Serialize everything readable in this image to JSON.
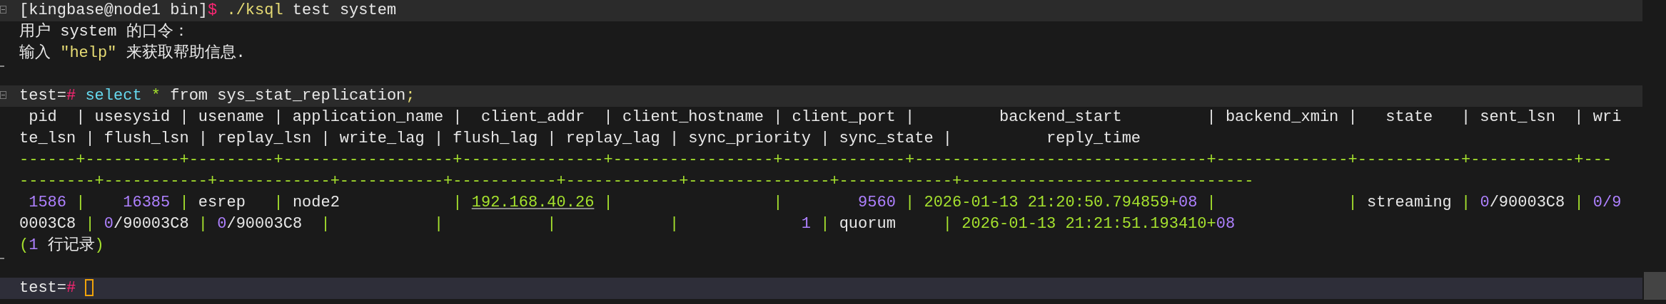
{
  "terminal": {
    "lines": [
      {
        "highlighted": true,
        "fold_start": true,
        "fold_end": false,
        "cursor": false,
        "segments": [
          {
            "text": "[kingbase@node1 bin]",
            "kind": "plain"
          },
          {
            "text": "$",
            "kind": "prompt"
          },
          {
            "text": " ./ksql",
            "kind": "command"
          },
          {
            "text": " test system",
            "kind": "plain"
          }
        ]
      },
      {
        "highlighted": false,
        "fold_start": false,
        "fold_end": false,
        "cursor": false,
        "segments": [
          {
            "text": "用户 system 的口令：",
            "kind": "plain"
          }
        ]
      },
      {
        "highlighted": false,
        "fold_start": false,
        "fold_end": false,
        "cursor": false,
        "segments": [
          {
            "text": "输入 ",
            "kind": "plain"
          },
          {
            "text": "\"help\"",
            "kind": "string"
          },
          {
            "text": " 来获取帮助信息.",
            "kind": "plain"
          }
        ]
      },
      {
        "highlighted": false,
        "fold_start": false,
        "fold_end": true,
        "cursor": false
      },
      {
        "highlighted": true,
        "fold_start": true,
        "fold_end": false,
        "cursor": false,
        "segments": [
          {
            "text": "test=",
            "kind": "plain"
          },
          {
            "text": "#",
            "kind": "prompt"
          },
          {
            "text": " select",
            "kind": "keyword"
          },
          {
            "text": " *",
            "kind": "operator"
          },
          {
            "text": " from sys_stat_replication",
            "kind": "plain"
          },
          {
            "text": ";",
            "kind": "punct"
          }
        ]
      },
      {
        "highlighted": false,
        "fold_start": false,
        "fold_end": false,
        "cursor": false,
        "segments": [
          {
            "text": " pid  | usesysid | usename | application_name |  client_addr  | client_hostname | client_port |         backend_start         | backend_xmin |   state   | sent_lsn  | wri",
            "kind": "plain"
          }
        ]
      },
      {
        "highlighted": false,
        "fold_start": false,
        "fold_end": false,
        "cursor": false,
        "segments": [
          {
            "text": "te_lsn | flush_lsn | replay_lsn | write_lag | flush_lag | replay_lag | sync_priority | sync_state |          reply_time",
            "kind": "plain"
          }
        ]
      },
      {
        "highlighted": false,
        "fold_start": false,
        "fold_end": false,
        "cursor": false,
        "segments": [
          {
            "text": "------+----------+---------+------------------+---------------+-----------------+-------------+-------------------------------+--------------+-----------+-----------+---",
            "kind": "border"
          }
        ]
      },
      {
        "highlighted": false,
        "fold_start": false,
        "fold_end": false,
        "cursor": false,
        "segments": [
          {
            "text": "--------+-----------+------------+-----------+-----------+------------+---------------+------------+-------------------------------",
            "kind": "border"
          }
        ]
      },
      {
        "highlighted": false,
        "fold_start": false,
        "fold_end": false,
        "cursor": false,
        "segments": [
          {
            "text": " 1586",
            "kind": "number"
          },
          {
            "text": " |    ",
            "kind": "border"
          },
          {
            "text": "16385",
            "kind": "number"
          },
          {
            "text": " | ",
            "kind": "border"
          },
          {
            "text": "esrep   ",
            "kind": "plain"
          },
          {
            "text": "| ",
            "kind": "border"
          },
          {
            "text": "node2            ",
            "kind": "plain"
          },
          {
            "text": "| ",
            "kind": "border"
          },
          {
            "text": "192.168.40.26",
            "kind": "address"
          },
          {
            "text": " |                 |        ",
            "kind": "border"
          },
          {
            "text": "9560",
            "kind": "number"
          },
          {
            "text": " | ",
            "kind": "border"
          },
          {
            "text": "2026-01-13 21:20:50.794859+",
            "kind": "timestamp"
          },
          {
            "text": "08",
            "kind": "number"
          },
          {
            "text": " |              | ",
            "kind": "border"
          },
          {
            "text": "streaming ",
            "kind": "plain"
          },
          {
            "text": "| ",
            "kind": "border"
          },
          {
            "text": "0",
            "kind": "number"
          },
          {
            "text": "/90003C8 ",
            "kind": "plain"
          },
          {
            "text": "| ",
            "kind": "border"
          },
          {
            "text": "0/9",
            "kind": "number"
          }
        ]
      },
      {
        "highlighted": false,
        "fold_start": false,
        "fold_end": false,
        "cursor": false,
        "segments": [
          {
            "text": "0003C8 ",
            "kind": "plain"
          },
          {
            "text": "| ",
            "kind": "border"
          },
          {
            "text": "0",
            "kind": "number"
          },
          {
            "text": "/90003C8 ",
            "kind": "plain"
          },
          {
            "text": "| ",
            "kind": "border"
          },
          {
            "text": "0",
            "kind": "number"
          },
          {
            "text": "/90003C8  ",
            "kind": "plain"
          },
          {
            "text": "|           |           |            |             ",
            "kind": "border"
          },
          {
            "text": "1",
            "kind": "number"
          },
          {
            "text": " | ",
            "kind": "border"
          },
          {
            "text": "quorum     ",
            "kind": "plain"
          },
          {
            "text": "| ",
            "kind": "border"
          },
          {
            "text": "2026-01-13 21:21:51.193410+",
            "kind": "timestamp"
          },
          {
            "text": "08",
            "kind": "number"
          }
        ]
      },
      {
        "highlighted": false,
        "fold_start": false,
        "fold_end": false,
        "cursor": false,
        "segments": [
          {
            "text": "(",
            "kind": "operator"
          },
          {
            "text": "1",
            "kind": "number"
          },
          {
            "text": " 行记录",
            "kind": "plain"
          },
          {
            "text": ")",
            "kind": "operator"
          }
        ]
      },
      {
        "highlighted": false,
        "fold_start": false,
        "fold_end": true,
        "cursor": false
      },
      {
        "highlighted": true,
        "fold_start": false,
        "fold_end": false,
        "cursor": true,
        "segments": [
          {
            "text": "test=",
            "kind": "plain"
          },
          {
            "text": "#",
            "kind": "prompt"
          }
        ]
      }
    ]
  }
}
